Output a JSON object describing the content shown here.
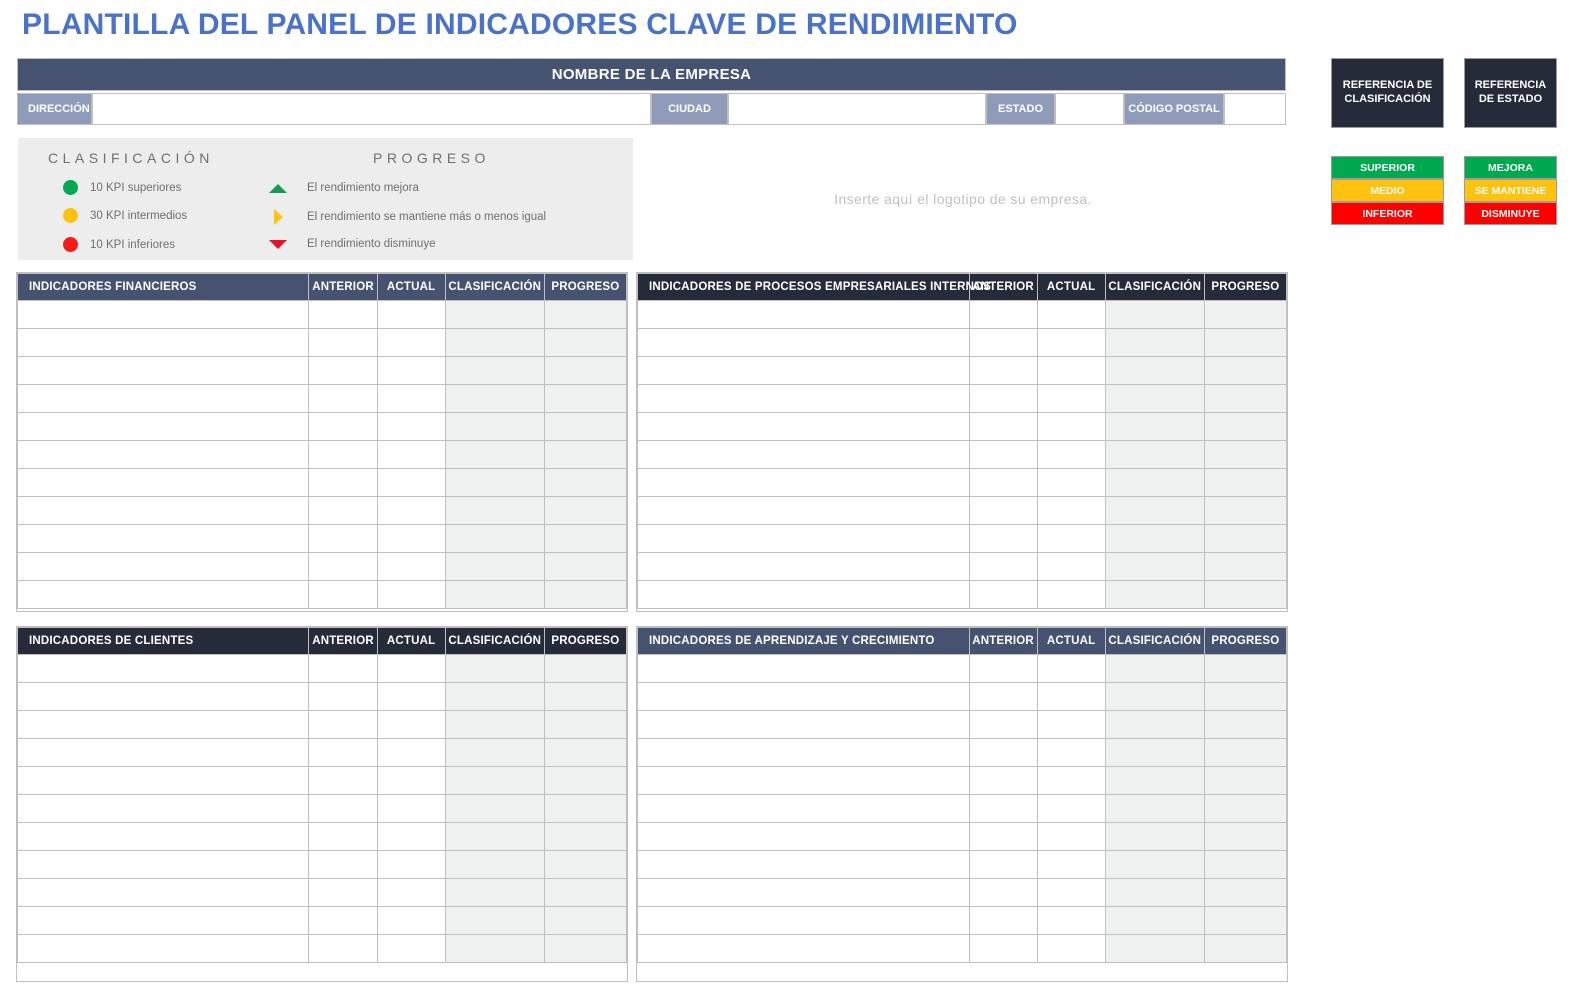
{
  "page_title": "PLANTILLA DEL PANEL DE INDICADORES CLAVE DE RENDIMIENTO",
  "colors": {
    "title_blue": "#4a72c8",
    "header_slate": "#455370",
    "header_dark": "#252b38",
    "label_blue_gray": "#8e9cb9",
    "green": "#00a94f",
    "yellow": "#ffc20e",
    "red": "#ff0000",
    "panel_gray": "#ededed",
    "shaded_cell": "#eff0f0"
  },
  "company_header": {
    "title": "NOMBRE DE LA EMPRESA"
  },
  "address_row": {
    "direccion_label": "DIRECCIÓN",
    "direccion_value": "",
    "ciudad_label": "CIUDAD",
    "ciudad_value": "",
    "estado_label": "ESTADO",
    "estado_value": "",
    "codigo_postal_label": "CÓDIGO POSTAL",
    "codigo_postal_value": ""
  },
  "legend": {
    "clasificacion_title": "CLASIFICACIÓN",
    "progreso_title": "PROGRESO",
    "clasificacion_items": [
      {
        "icon": "green-circle-icon",
        "label": "10 KPI superiores"
      },
      {
        "icon": "yellow-circle-icon",
        "label": "30 KPI intermedios"
      },
      {
        "icon": "red-circle-icon",
        "label": "10 KPI inferiores"
      }
    ],
    "progreso_items": [
      {
        "icon": "green-triangle-up-icon",
        "label": "El rendimiento mejora"
      },
      {
        "icon": "yellow-triangle-right-icon",
        "label": "El rendimiento se mantiene más o menos igual"
      },
      {
        "icon": "red-triangle-down-icon",
        "label": "El rendimiento disminuye"
      }
    ]
  },
  "logo_placeholder": "Inserte aquí el logotipo de su empresa.",
  "reference_clasificacion": {
    "heading": "REFERENCIA DE CLASIFICACIÓN",
    "chips": [
      {
        "label": "SUPERIOR",
        "color": "#00a94f"
      },
      {
        "label": "MEDIO",
        "color": "#ffc20e"
      },
      {
        "label": "INFERIOR",
        "color": "#ff0000"
      }
    ]
  },
  "reference_estado": {
    "heading": "REFERENCIA DE ESTADO",
    "chips": [
      {
        "label": "MEJORA",
        "color": "#00a94f"
      },
      {
        "label": "SE MANTIENE",
        "color": "#ffc20e"
      },
      {
        "label": "DISMINUYE",
        "color": "#ff0000"
      }
    ]
  },
  "common_columns": {
    "anterior": "ANTERIOR",
    "actual": "ACTUAL",
    "clasificacion": "CLASIFICACIÓN",
    "progreso": "PROGRESO"
  },
  "tables": [
    {
      "id": "financieros",
      "title": "INDICADORES FINANCIEROS",
      "header_style": "slate",
      "row_count": 11,
      "rows": []
    },
    {
      "id": "procesos",
      "title": "INDICADORES DE PROCESOS EMPRESARIALES INTERNOS",
      "header_style": "dark",
      "row_count": 11,
      "rows": []
    },
    {
      "id": "clientes",
      "title": "INDICADORES DE CLIENTES",
      "header_style": "dark",
      "row_count": 11,
      "rows": []
    },
    {
      "id": "aprendizaje",
      "title": "INDICADORES DE APRENDIZAJE Y CRECIMIENTO",
      "header_style": "slate",
      "row_count": 11,
      "rows": []
    }
  ]
}
